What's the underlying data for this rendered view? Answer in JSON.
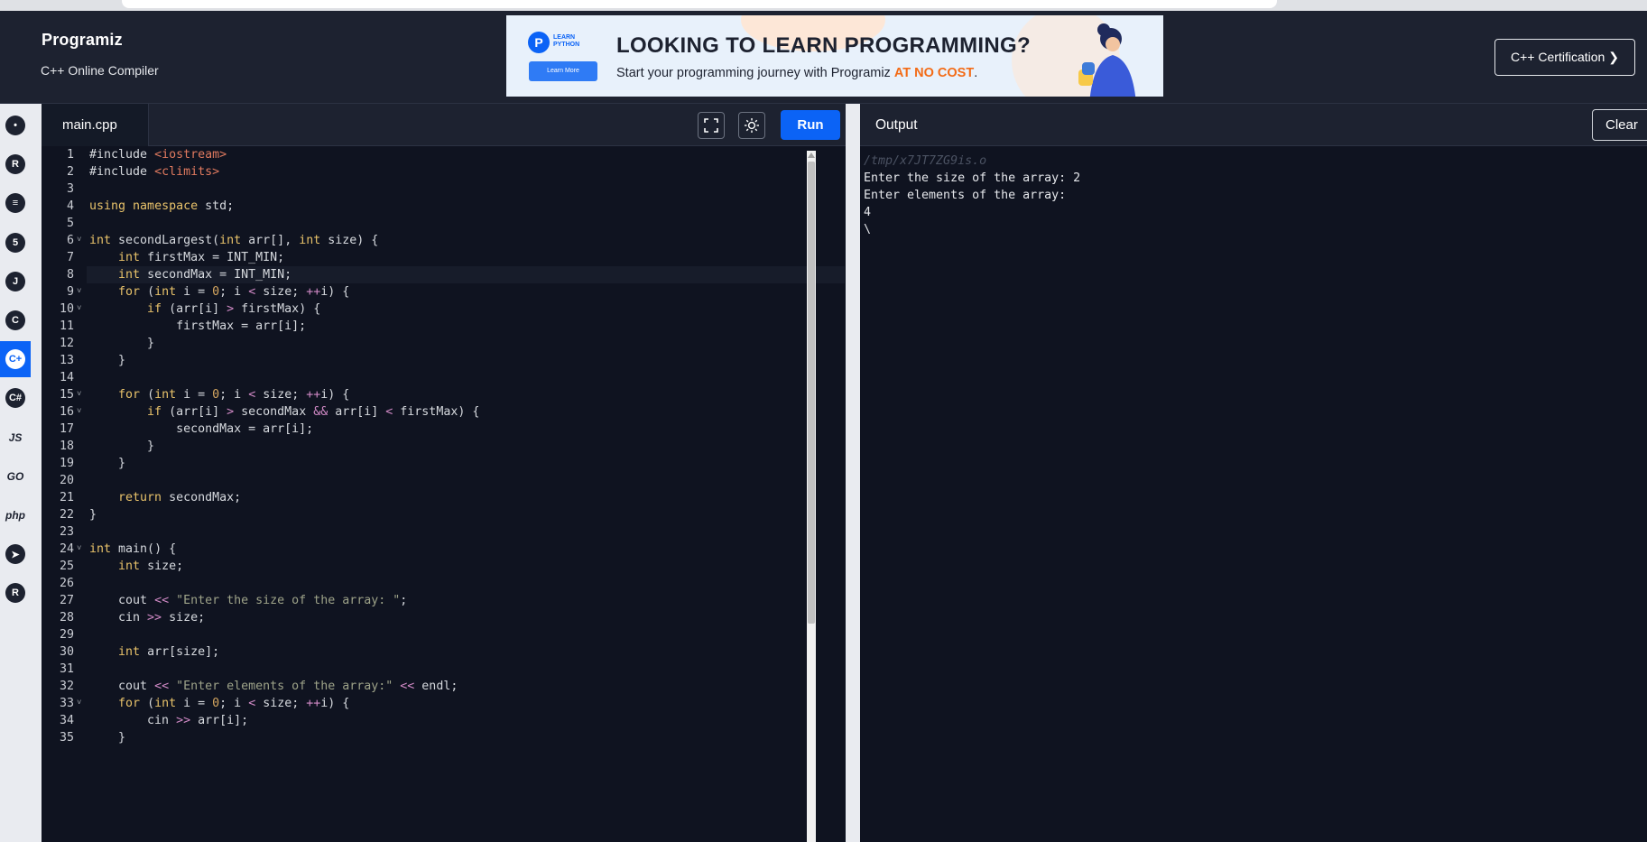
{
  "header": {
    "logo_text": "Programiz",
    "subtitle": "C++ Online Compiler",
    "cert_button": "C++ Certification ❯",
    "ad": {
      "badge_text": "LEARN PYTHON",
      "learn_more": "Learn More",
      "headline": "LOOKING TO LEARN PROGRAMMING?",
      "tagline_prefix": "Start your programming journey with Programiz ",
      "tagline_highlight": "AT NO COST",
      "tagline_suffix": "."
    }
  },
  "sidebar": {
    "items": [
      {
        "name": "python",
        "icon": "python-icon",
        "glyph": "•"
      },
      {
        "name": "r",
        "icon": "r-icon",
        "glyph": "R"
      },
      {
        "name": "sql",
        "icon": "database-icon",
        "glyph": "≡"
      },
      {
        "name": "html",
        "icon": "html5-icon",
        "glyph": "5"
      },
      {
        "name": "java",
        "icon": "java-icon",
        "glyph": "J"
      },
      {
        "name": "c",
        "icon": "c-icon",
        "glyph": "C"
      },
      {
        "name": "cpp",
        "icon": "cpp-icon",
        "glyph": "C+",
        "active": true
      },
      {
        "name": "csharp",
        "icon": "csharp-icon",
        "glyph": "C#"
      },
      {
        "name": "js",
        "icon": "javascript-icon",
        "text": "JS"
      },
      {
        "name": "go",
        "icon": "go-icon",
        "text": "GO"
      },
      {
        "name": "php",
        "icon": "php-icon",
        "text": "php"
      },
      {
        "name": "swift",
        "icon": "swift-icon",
        "glyph": "➤"
      },
      {
        "name": "rust",
        "icon": "rust-icon",
        "glyph": "R"
      }
    ]
  },
  "editor": {
    "tab_label": "main.cpp",
    "run_label": "Run",
    "lines": [
      {
        "n": "1",
        "html": "<span class=\"plain\">#include </span><span class=\"inc\">&lt;iostream&gt;</span>"
      },
      {
        "n": "2",
        "html": "<span class=\"plain\">#include </span><span class=\"inc\">&lt;climits&gt;</span>"
      },
      {
        "n": "3",
        "html": ""
      },
      {
        "n": "4",
        "html": "<span class=\"kw\">using</span> <span class=\"kw\">namespace</span> std;"
      },
      {
        "n": "5",
        "html": ""
      },
      {
        "n": "6",
        "fold": true,
        "html": "<span class=\"kw\">int</span> secondLargest(<span class=\"kw\">int</span> arr[], <span class=\"kw\">int</span> size) {"
      },
      {
        "n": "7",
        "html": "    <span class=\"kw\">int</span> firstMax = INT_MIN;"
      },
      {
        "n": "8",
        "cur": true,
        "html": "    <span class=\"kw\">int</span> secondMax = INT_MIN;"
      },
      {
        "n": "9",
        "fold": true,
        "html": "    <span class=\"kw\">for</span> (<span class=\"kw\">int</span> i = <span class=\"num\">0</span>; i <span class=\"op\">&lt;</span> size; <span class=\"op\">++</span>i) {"
      },
      {
        "n": "10",
        "fold": true,
        "html": "        <span class=\"kw\">if</span> (arr[i] <span class=\"op\">&gt;</span> firstMax) {"
      },
      {
        "n": "11",
        "html": "            firstMax = arr[i];"
      },
      {
        "n": "12",
        "html": "        }"
      },
      {
        "n": "13",
        "html": "    }"
      },
      {
        "n": "14",
        "html": ""
      },
      {
        "n": "15",
        "fold": true,
        "html": "    <span class=\"kw\">for</span> (<span class=\"kw\">int</span> i = <span class=\"num\">0</span>; i <span class=\"op\">&lt;</span> size; <span class=\"op\">++</span>i) {"
      },
      {
        "n": "16",
        "fold": true,
        "html": "        <span class=\"kw\">if</span> (arr[i] <span class=\"op\">&gt;</span> secondMax <span class=\"op\">&amp;&amp;</span> arr[i] <span class=\"op\">&lt;</span> firstMax) {"
      },
      {
        "n": "17",
        "html": "            secondMax = arr[i];"
      },
      {
        "n": "18",
        "html": "        }"
      },
      {
        "n": "19",
        "html": "    }"
      },
      {
        "n": "20",
        "html": ""
      },
      {
        "n": "21",
        "html": "    <span class=\"kw\">return</span> secondMax;"
      },
      {
        "n": "22",
        "html": "}"
      },
      {
        "n": "23",
        "html": ""
      },
      {
        "n": "24",
        "fold": true,
        "html": "<span class=\"kw\">int</span> main() {"
      },
      {
        "n": "25",
        "html": "    <span class=\"kw\">int</span> size;"
      },
      {
        "n": "26",
        "html": ""
      },
      {
        "n": "27",
        "html": "    cout <span class=\"op\">&lt;&lt;</span> <span class=\"str\">\"Enter the size of the array: \"</span>;"
      },
      {
        "n": "28",
        "html": "    cin <span class=\"op\">&gt;&gt;</span> size;"
      },
      {
        "n": "29",
        "html": ""
      },
      {
        "n": "30",
        "html": "    <span class=\"kw\">int</span> arr[size];"
      },
      {
        "n": "31",
        "html": ""
      },
      {
        "n": "32",
        "html": "    cout <span class=\"op\">&lt;&lt;</span> <span class=\"str\">\"Enter elements of the array:\"</span> <span class=\"op\">&lt;&lt;</span> endl;"
      },
      {
        "n": "33",
        "fold": true,
        "html": "    <span class=\"kw\">for</span> (<span class=\"kw\">int</span> i = <span class=\"num\">0</span>; i <span class=\"op\">&lt;</span> size; <span class=\"op\">++</span>i) {"
      },
      {
        "n": "34",
        "html": "        cin <span class=\"op\">&gt;&gt;</span> arr[i];"
      },
      {
        "n": "35",
        "html": "    }"
      }
    ]
  },
  "output": {
    "title": "Output",
    "clear_label": "Clear",
    "lines": [
      {
        "text": "/tmp/x7JT7ZG9is.o",
        "path": true
      },
      {
        "text": "Enter the size of the array: 2"
      },
      {
        "text": "Enter elements of the array:"
      },
      {
        "text": "4"
      },
      {
        "text": "\\"
      }
    ]
  },
  "colors": {
    "accent": "#0b63f6",
    "header_bg": "#1d2230",
    "editor_bg": "#0f1320",
    "ad_highlight": "#f36b16"
  }
}
